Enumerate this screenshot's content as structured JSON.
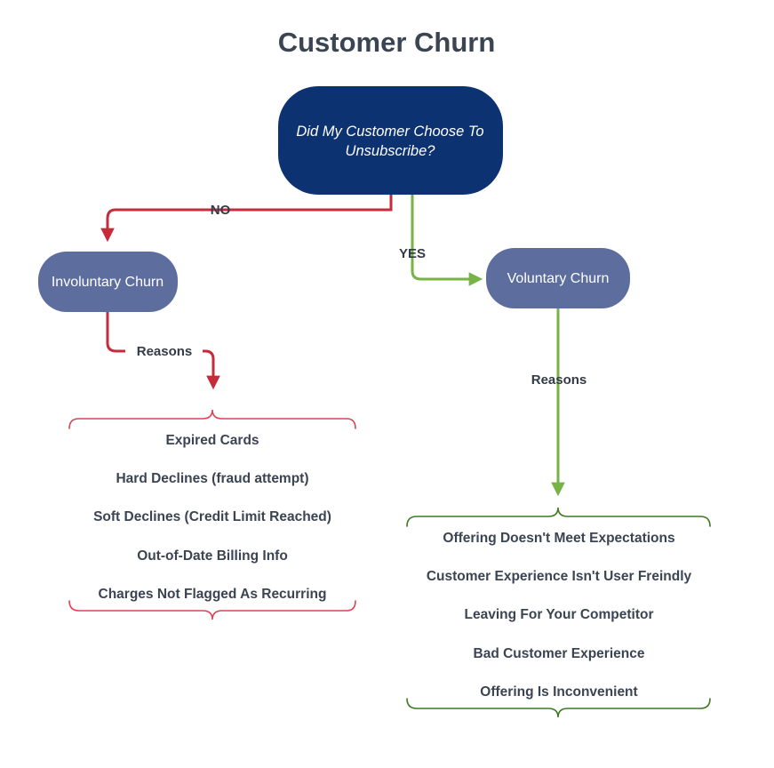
{
  "title": "Customer Churn",
  "colors": {
    "root_node_fill": "#0d3272",
    "branch_node_fill": "#5d6d9e",
    "no_branch": "#c62b3c",
    "yes_branch": "#78b348",
    "text_dark": "#3b4452",
    "node_text": "#ffffff",
    "background": "#ffffff"
  },
  "root_node": {
    "label_line1": "Did My Customer Choose To",
    "label_line2": "Unsubscribe?"
  },
  "branches": {
    "no": {
      "edge_label": "NO",
      "node_label": "Involuntary Churn",
      "reasons_label": "Reasons",
      "reasons": [
        "Expired Cards",
        "Hard Declines (fraud attempt)",
        "Soft Declines (Credit Limit Reached)",
        "Out-of-Date Billing Info",
        "Charges Not Flagged As Recurring"
      ]
    },
    "yes": {
      "edge_label": "YES",
      "node_label": "Voluntary Churn",
      "reasons_label": "Reasons",
      "reasons": [
        "Offering Doesn't Meet Expectations",
        "Customer Experience Isn't User Freindly",
        "Leaving For Your Competitor",
        "Bad Customer Experience",
        "Offering Is Inconvenient"
      ]
    }
  }
}
